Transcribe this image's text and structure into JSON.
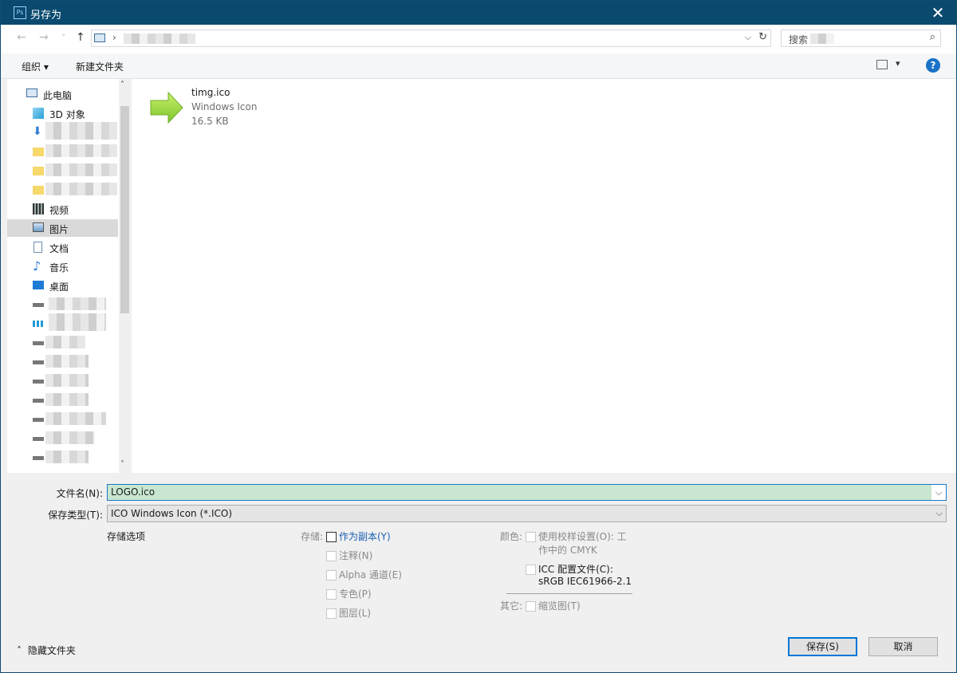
{
  "window": {
    "title": "另存为",
    "app_icon_text": "Ps",
    "close_symbol": "✕"
  },
  "address": {
    "back": "←",
    "forward": "→",
    "recent": "˅",
    "up": "↑",
    "separator": "›",
    "dropdown": "⌵",
    "refresh": "↻"
  },
  "search": {
    "placeholder": "搜索",
    "icon": "⌕"
  },
  "toolbar": {
    "organize_label": "组织 ▾",
    "new_folder_label": "新建文件夹",
    "view_dropdown": "▾",
    "help_label": "?"
  },
  "navigation": {
    "items": [
      {
        "label": "此电脑",
        "icon": "pc-icon"
      },
      {
        "label": "3D 对象",
        "icon": "cube-icon"
      },
      {
        "label": "视频",
        "icon": "video-icon"
      },
      {
        "label": "图片",
        "icon": "pictures-icon",
        "selected": true
      },
      {
        "label": "文档",
        "icon": "document-icon"
      },
      {
        "label": "音乐",
        "icon": "music-icon"
      },
      {
        "label": "桌面",
        "icon": "desktop-icon"
      }
    ],
    "scroll_up": "˄",
    "scroll_down": "˅"
  },
  "files": [
    {
      "name": "timg.ico",
      "type": "Windows Icon",
      "size": "16.5 KB"
    }
  ],
  "form": {
    "filename_label": "文件名(N):",
    "filename_value": "LOGO.ico",
    "filetype_label": "保存类型(T):",
    "filetype_value": "ICO  Windows Icon  (*.ICO)",
    "dropdown_symbol": "⌵"
  },
  "options": {
    "section_title": "存储选项",
    "storage_label": "存储:",
    "storage": [
      {
        "label": "作为副本(Y)",
        "checked": false,
        "enabled": true
      },
      {
        "label": "注释(N)",
        "checked": false,
        "enabled": false
      },
      {
        "label": "Alpha 通道(E)",
        "checked": false,
        "enabled": false
      },
      {
        "label": "专色(P)",
        "checked": false,
        "enabled": false
      },
      {
        "label": "图层(L)",
        "checked": false,
        "enabled": false
      }
    ],
    "color_label": "颜色:",
    "proof_line1": "使用校样设置(O): 工",
    "proof_line2": "作中的 CMYK",
    "icc_line1": "ICC 配置文件(C):",
    "icc_line2": "sRGB IEC61966-2.1",
    "other_label": "其它:",
    "thumbnail_label": "缩览图(T)"
  },
  "footer": {
    "hide_folders_label": "隐藏文件夹",
    "hide_folders_icon": "˄",
    "save_label": "保存(S)",
    "cancel_label": "取消"
  },
  "colors": {
    "titlebar": "#0b4a6f",
    "accent": "#0078d7",
    "filename_highlight": "#c8e6d0",
    "selected_nav": "#d9d9d9"
  }
}
